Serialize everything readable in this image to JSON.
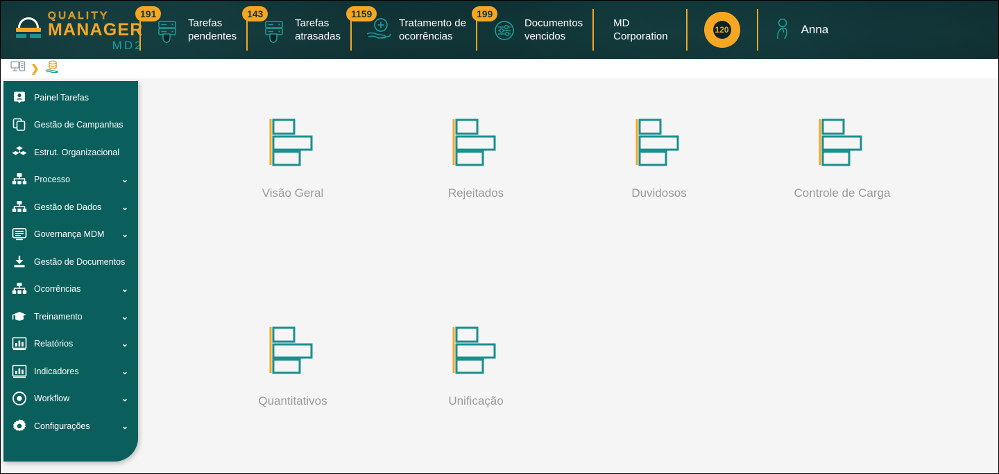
{
  "header": {
    "logo": {
      "line1": "QUALITY",
      "line2": "MANAGER",
      "line3": "MD2",
      "mark_icon": "quality-manager-logo-icon"
    },
    "stats": [
      {
        "badge": "191",
        "label": "Tarefas\npendentes",
        "icon": "server-shield-icon"
      },
      {
        "badge": "143",
        "label": "Tarefas\natrasadas",
        "icon": "server-shield-icon"
      },
      {
        "badge": "1159",
        "label": "Tratamento de\nocorrências",
        "icon": "hand-plus-icon"
      },
      {
        "badge": "199",
        "label": "Documentos\nvencidos",
        "icon": "sliders-circle-icon"
      }
    ],
    "organization": "MD\nCorporation",
    "counter": {
      "value": "120",
      "icon": "donut-counter-icon"
    },
    "user": {
      "name": "Anna",
      "icon": "user-avatar-icon"
    }
  },
  "breadcrumb": {
    "items": [
      {
        "icon": "desktop-monitor-icon"
      },
      {
        "icon": "chevron-right-icon",
        "glyph": "❯"
      },
      {
        "icon": "hand-data-stack-icon"
      }
    ]
  },
  "sidebar": {
    "items": [
      {
        "label": "Painel Tarefas",
        "icon": "user-card-icon",
        "expandable": false
      },
      {
        "label": "Gestão de Campanhas",
        "icon": "copy-layers-icon",
        "expandable": false
      },
      {
        "label": "Estrut. Organizacional",
        "icon": "cubes-icon",
        "expandable": false
      },
      {
        "label": "Processo",
        "icon": "hierarchy-icon",
        "expandable": true
      },
      {
        "label": "Gestão de Dados",
        "icon": "hierarchy-icon",
        "expandable": true
      },
      {
        "label": "Governança MDM",
        "icon": "list-window-icon",
        "expandable": true
      },
      {
        "label": "Gestão de Documentos",
        "icon": "download-icon",
        "expandable": false
      },
      {
        "label": "Ocorrências",
        "icon": "hierarchy-icon",
        "expandable": true
      },
      {
        "label": "Treinamento",
        "icon": "graduation-cap-icon",
        "expandable": true
      },
      {
        "label": "Relatórios",
        "icon": "bar-chart-icon",
        "expandable": true
      },
      {
        "label": "Indicadores",
        "icon": "bar-chart-icon",
        "expandable": true
      },
      {
        "label": "Workflow",
        "icon": "target-dot-icon",
        "expandable": true
      },
      {
        "label": "Configurações",
        "icon": "gear-icon",
        "expandable": true
      }
    ],
    "chevron_glyph": "⌄"
  },
  "main": {
    "tiles": [
      {
        "label": "Visão Geral",
        "icon": "horizontal-bar-chart-icon"
      },
      {
        "label": "Rejeitados",
        "icon": "horizontal-bar-chart-icon"
      },
      {
        "label": "Duvidosos",
        "icon": "horizontal-bar-chart-icon"
      },
      {
        "label": "Controle de Carga",
        "icon": "horizontal-bar-chart-icon"
      },
      {
        "label": "Quantitativos",
        "icon": "horizontal-bar-chart-icon"
      },
      {
        "label": "Unificação",
        "icon": "horizontal-bar-chart-icon"
      }
    ]
  },
  "colors": {
    "accent_yellow": "#f5a623",
    "teal": "#0a5f5c",
    "icon_teal": "#1a8f8f",
    "header_dark": "#0b1f22",
    "content_bg": "#f5f5f5",
    "tile_label": "#9b9b9b"
  }
}
